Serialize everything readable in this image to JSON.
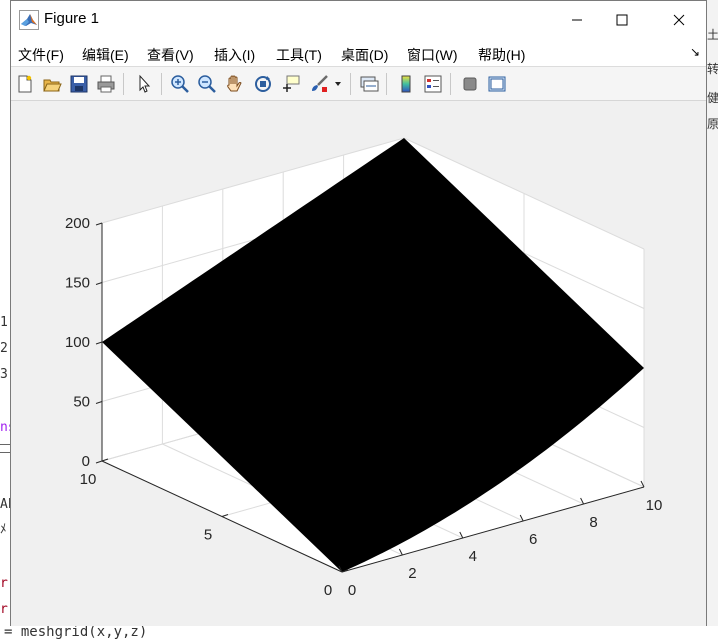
{
  "window": {
    "title": "Figure 1",
    "controls": [
      "minimize",
      "maximize",
      "close"
    ]
  },
  "menu": {
    "items": [
      "文件(F)",
      "编辑(E)",
      "查看(V)",
      "插入(I)",
      "工具(T)",
      "桌面(D)",
      "窗口(W)",
      "帮助(H)"
    ],
    "overflow": "↘"
  },
  "toolbar": {
    "icons": [
      "new-figure-icon",
      "open-icon",
      "save-icon",
      "print-icon",
      "select-arrow-icon",
      "zoom-in-icon",
      "zoom-out-icon",
      "pan-hand-icon",
      "rotate-3d-icon",
      "data-cursor-icon",
      "brush-icon",
      "link-plot-icon",
      "colorbar-icon",
      "legend-icon",
      "hide-plot-tools-icon",
      "show-plot-tools-icon"
    ]
  },
  "background": {
    "lines": [
      "1",
      "2",
      "3",
      "ns",
      "AE",
      "ﾒ",
      "r",
      "r",
      "= meshgrid(x,y,z)"
    ],
    "right_fragments": [
      "土",
      "转",
      "健",
      "原"
    ]
  },
  "chart_data": {
    "type": "surface",
    "surface_color": "#000000",
    "x_ticks": [
      "0",
      "2",
      "4",
      "6",
      "8",
      "10"
    ],
    "y_ticks": [
      "0",
      "5",
      "10"
    ],
    "z_ticks": [
      "0",
      "50",
      "100",
      "150",
      "200"
    ],
    "xlim": [
      0,
      10
    ],
    "ylim": [
      0,
      10
    ],
    "zlim": [
      0,
      200
    ],
    "corners": [
      {
        "x": 0,
        "y": 0,
        "z": 0
      },
      {
        "x": 10,
        "y": 0,
        "z": 100
      },
      {
        "x": 0,
        "y": 10,
        "z": 100
      },
      {
        "x": 10,
        "y": 10,
        "z": 200
      }
    ],
    "grid": true,
    "view": "3d"
  }
}
